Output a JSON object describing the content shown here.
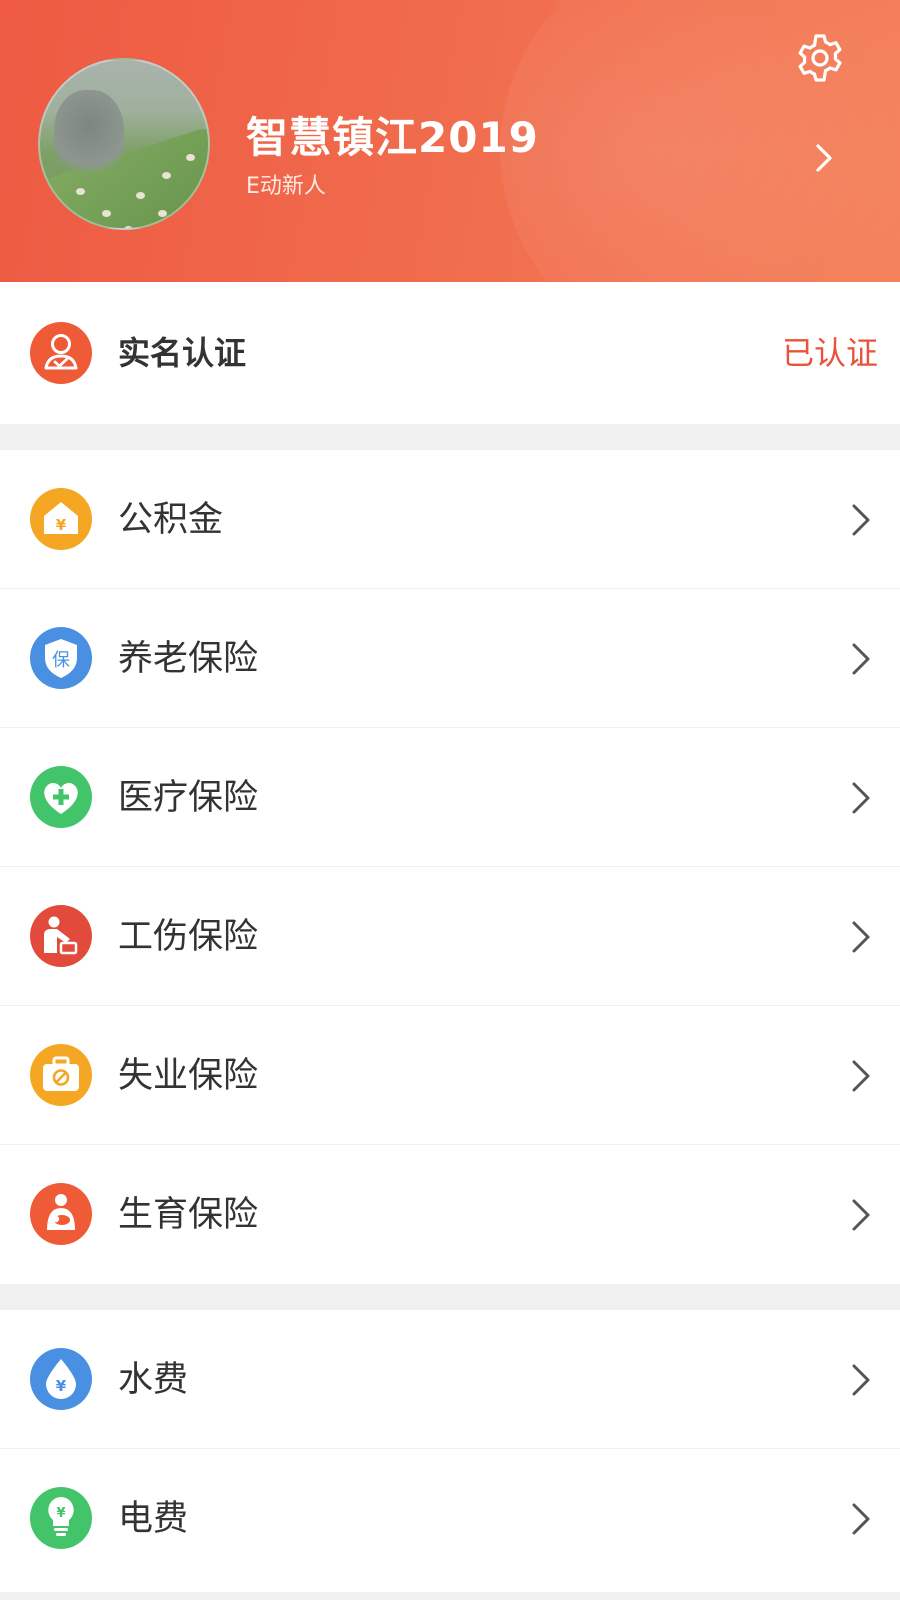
{
  "profile": {
    "name": "智慧镇江2019",
    "tag": "E动新人"
  },
  "verification": {
    "label": "实名认证",
    "status": "已认证"
  },
  "groups": [
    {
      "items": [
        {
          "label": "公积金",
          "icon": "housing-fund-icon",
          "color": "#f5a623"
        },
        {
          "label": "养老保险",
          "icon": "pension-shield-icon",
          "color": "#4a90e2"
        },
        {
          "label": "医疗保险",
          "icon": "medical-heart-icon",
          "color": "#43c46a"
        },
        {
          "label": "工伤保险",
          "icon": "work-injury-icon",
          "color": "#e24b3b"
        },
        {
          "label": "失业保险",
          "icon": "unemployment-bag-icon",
          "color": "#f5a623"
        },
        {
          "label": "生育保险",
          "icon": "maternity-icon",
          "color": "#ef5a37"
        }
      ]
    },
    {
      "items": [
        {
          "label": "水费",
          "icon": "water-drop-icon",
          "color": "#4a90e2"
        },
        {
          "label": "电费",
          "icon": "lightbulb-icon",
          "color": "#43c46a"
        }
      ]
    }
  ],
  "colors": {
    "header": "#ef5f45",
    "accent_status": "#e9533c",
    "separator": "#f0f0f0"
  }
}
